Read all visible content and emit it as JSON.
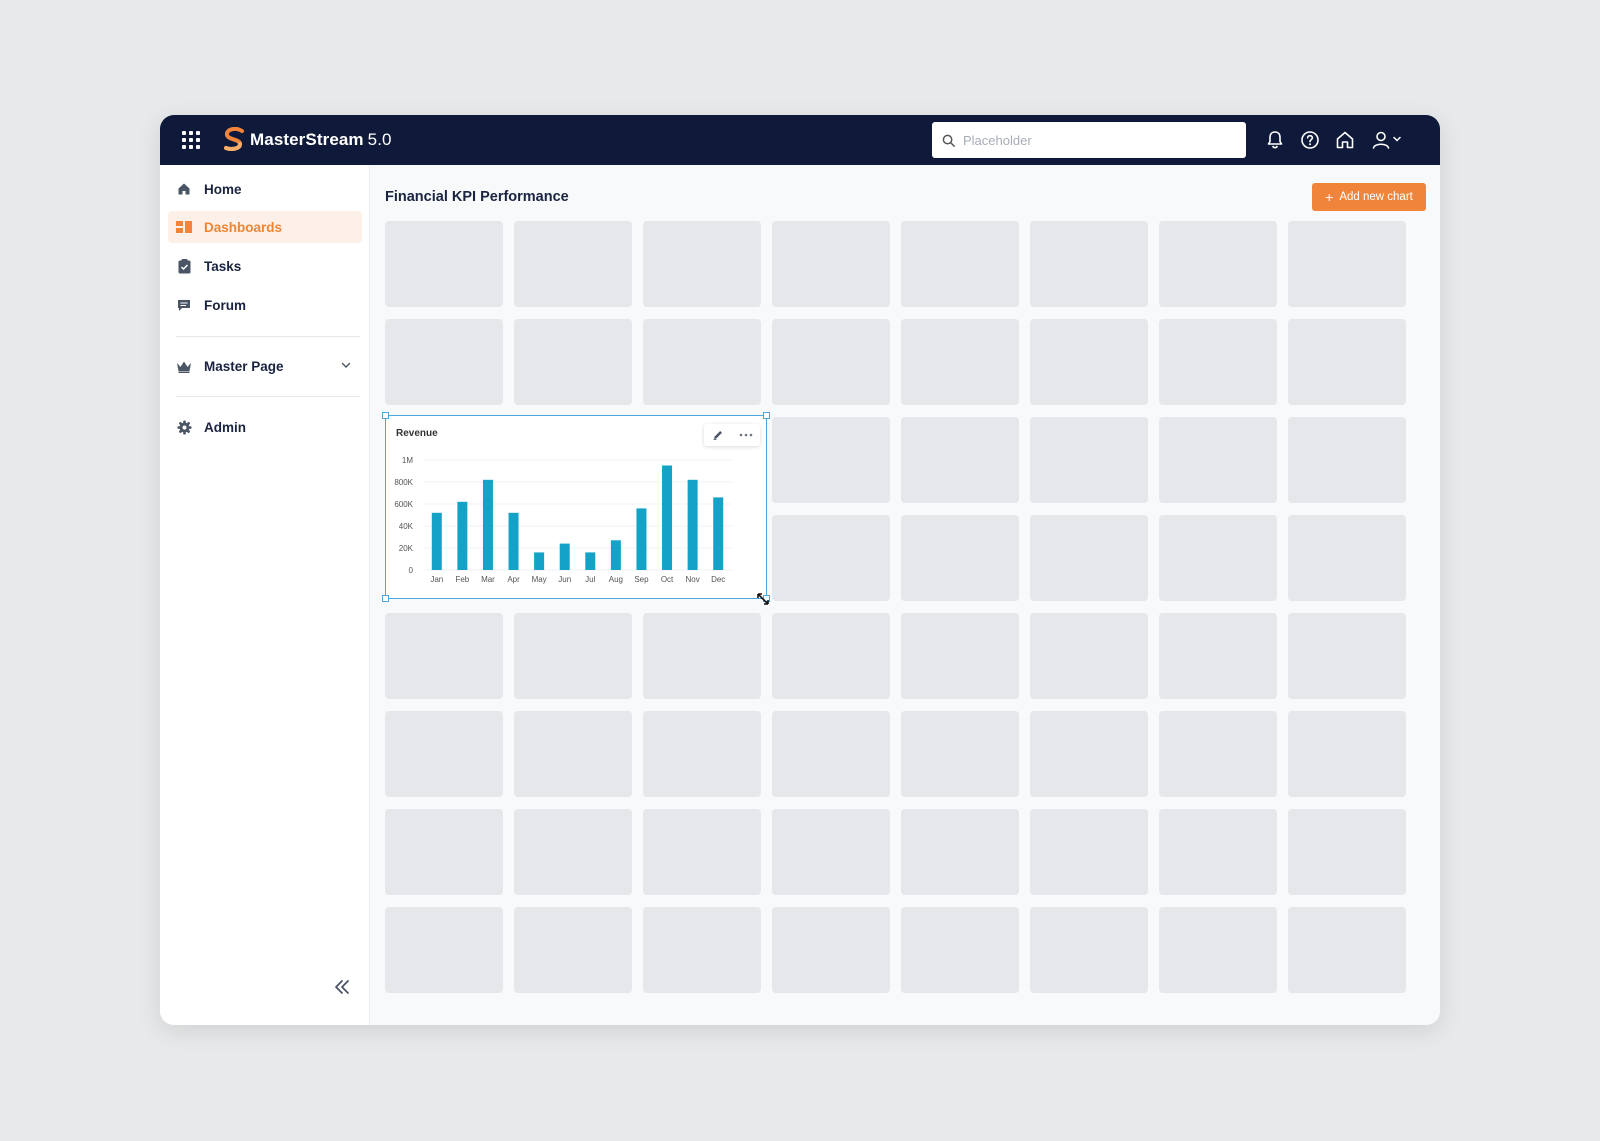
{
  "app": {
    "name": "MasterStream",
    "version": "5.0",
    "accent_color": "#f0843a",
    "topbar_color": "#0f1a3a"
  },
  "search": {
    "placeholder": "Placeholder",
    "value": ""
  },
  "topbar_icons": [
    "apps-grid-icon",
    "bell-icon",
    "help-icon",
    "home-icon",
    "user-icon",
    "chevron-down-icon"
  ],
  "sidebar": {
    "items": [
      {
        "label": "Home",
        "icon": "home-icon",
        "active": false
      },
      {
        "label": "Dashboards",
        "icon": "dashboard-icon",
        "active": true
      },
      {
        "label": "Tasks",
        "icon": "clipboard-check-icon",
        "active": false
      },
      {
        "label": "Forum",
        "icon": "chat-icon",
        "active": false
      },
      {
        "label": "Master Page",
        "icon": "crown-icon",
        "active": false,
        "expandable": true
      },
      {
        "label": "Admin",
        "icon": "gear-icon",
        "active": false
      }
    ],
    "collapse_icon": "double-chevron-left-icon"
  },
  "main": {
    "title": "Financial KPI Performance",
    "add_button_label": "Add new chart"
  },
  "widget": {
    "title": "Revenue",
    "actions": [
      "edit-icon",
      "more-icon"
    ]
  },
  "chart_data": {
    "type": "bar",
    "title": "Revenue",
    "categories": [
      "Jan",
      "Feb",
      "Mar",
      "Apr",
      "May",
      "Jun",
      "Jul",
      "Aug",
      "Sep",
      "Oct",
      "Nov",
      "Dec"
    ],
    "values": [
      520000,
      620000,
      820000,
      520000,
      160000,
      240000,
      160000,
      270000,
      560000,
      950000,
      820000,
      660000
    ],
    "y_ticks": [
      "0",
      "20K",
      "40K",
      "600K",
      "800K",
      "1M"
    ],
    "y_tick_values": [
      0,
      200000,
      400000,
      600000,
      800000,
      1000000
    ],
    "ylim": [
      0,
      1000000
    ],
    "bar_color": "#14a3c7",
    "grid": true
  }
}
